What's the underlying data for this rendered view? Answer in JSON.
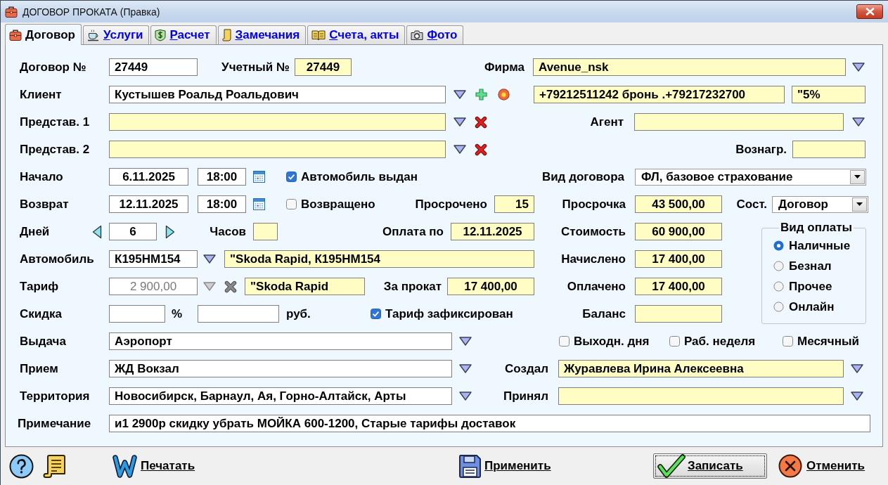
{
  "window": {
    "title": "ДОГОВОР ПРОКАТА (Правка)"
  },
  "tabs": [
    {
      "label": "Договор",
      "selected": true
    },
    {
      "label": "Услуги",
      "selected": false
    },
    {
      "label": "Расчет",
      "selected": false
    },
    {
      "label": "Замечания",
      "selected": false
    },
    {
      "label": "Счета, акты",
      "selected": false
    },
    {
      "label": "Фото",
      "selected": false
    }
  ],
  "form": {
    "rows": [
      {
        "items": [
          {
            "kind": "label",
            "text": "Договор №"
          },
          {
            "kind": "field",
            "value": "27449",
            "readonly": false
          },
          {
            "kind": "label",
            "text": "Учетный №"
          },
          {
            "kind": "field",
            "value": "27449",
            "readonly": true
          },
          {
            "kind": "label",
            "text": "Фирма"
          },
          {
            "kind": "field",
            "value": "Avenue_nsk",
            "readonly": true
          }
        ]
      },
      {
        "items": [
          {
            "kind": "label",
            "text": "Клиент"
          },
          {
            "kind": "field",
            "value": "Кустышев Роальд Роальдович",
            "readonly": false
          },
          {
            "kind": "field",
            "value": "+79212511242 бронь .+79217232700",
            "readonly": true
          },
          {
            "kind": "field",
            "value": "\"5%",
            "readonly": true
          }
        ]
      },
      {
        "items": [
          {
            "kind": "label",
            "text": "Представ. 1"
          },
          {
            "kind": "field",
            "readonly": true
          },
          {
            "kind": "label",
            "text": "Агент"
          },
          {
            "kind": "field",
            "readonly": true
          }
        ]
      },
      {
        "items": [
          {
            "kind": "label",
            "text": "Представ. 2"
          },
          {
            "kind": "field",
            "readonly": true
          },
          {
            "kind": "label",
            "text": "Вознагр."
          },
          {
            "kind": "field",
            "readonly": true
          }
        ]
      },
      {
        "items": [
          {
            "kind": "label",
            "text": "Начало"
          },
          {
            "kind": "field",
            "value": "6.11.2025",
            "readonly": false
          },
          {
            "kind": "field",
            "value": "18:00",
            "readonly": false
          },
          {
            "kind": "check",
            "label": "Автомобиль выдан",
            "checked": true
          },
          {
            "kind": "label",
            "text": "Вид договора"
          },
          {
            "kind": "combo",
            "value": "ФЛ, базовое страхование"
          }
        ]
      },
      {
        "items": [
          {
            "kind": "label",
            "text": "Возврат"
          },
          {
            "kind": "field",
            "value": "12.11.2025",
            "readonly": false
          },
          {
            "kind": "field",
            "value": "18:00",
            "readonly": false
          },
          {
            "kind": "check",
            "label": "Возвращено",
            "checked": false
          },
          {
            "kind": "label",
            "text": "Просрочено"
          },
          {
            "kind": "field",
            "value": "15",
            "readonly": true
          },
          {
            "kind": "label",
            "text": "Просрочка"
          },
          {
            "kind": "field",
            "value": "43 500,00",
            "readonly": true
          },
          {
            "kind": "label",
            "text": "Сост."
          },
          {
            "kind": "combo",
            "value": "Договор"
          }
        ]
      },
      {
        "items": [
          {
            "kind": "label",
            "text": "Дней"
          },
          {
            "kind": "field",
            "value": "6",
            "readonly": false
          },
          {
            "kind": "label",
            "text": "Часов"
          },
          {
            "kind": "field",
            "readonly": true
          },
          {
            "kind": "label",
            "text": "Оплата по"
          },
          {
            "kind": "field",
            "value": "12.11.2025",
            "readonly": true
          },
          {
            "kind": "label",
            "text": "Стоимость"
          },
          {
            "kind": "field",
            "value": "60 900,00",
            "readonly": true
          }
        ]
      },
      {
        "items": [
          {
            "kind": "label",
            "text": "Автомобиль"
          },
          {
            "kind": "field",
            "value": "К195НМ154",
            "readonly": false
          },
          {
            "kind": "field",
            "value": "\"Skoda Rapid, К195НМ154",
            "readonly": true
          },
          {
            "kind": "label",
            "text": "Начислено"
          },
          {
            "kind": "field",
            "value": "17 400,00",
            "readonly": true
          }
        ]
      },
      {
        "items": [
          {
            "kind": "label",
            "text": "Тариф"
          },
          {
            "kind": "field",
            "value": "2 900,00",
            "readonly": false,
            "disabled": true
          },
          {
            "kind": "field",
            "value": "\"Skoda Rapid",
            "readonly": true
          },
          {
            "kind": "label",
            "text": "За прокат"
          },
          {
            "kind": "field",
            "value": "17 400,00",
            "readonly": true
          },
          {
            "kind": "label",
            "text": "Оплачено"
          },
          {
            "kind": "field",
            "value": "17 400,00",
            "readonly": true
          }
        ]
      },
      {
        "items": [
          {
            "kind": "label",
            "text": "Скидка"
          },
          {
            "kind": "field",
            "readonly": false
          },
          {
            "kind": "label",
            "text": "%"
          },
          {
            "kind": "field",
            "readonly": false
          },
          {
            "kind": "label",
            "text": "руб."
          },
          {
            "kind": "check",
            "label": "Тариф зафиксирован",
            "checked": true
          },
          {
            "kind": "label",
            "text": "Баланс"
          },
          {
            "kind": "field",
            "readonly": true
          }
        ]
      },
      {
        "items": [
          {
            "kind": "label",
            "text": "Выдача"
          },
          {
            "kind": "field",
            "value": "Аэропорт",
            "readonly": false
          },
          {
            "kind": "check",
            "label": "Выходн. дня",
            "checked": false
          },
          {
            "kind": "check",
            "label": "Раб. неделя",
            "checked": false
          },
          {
            "kind": "check",
            "label": "Месячный",
            "checked": false
          }
        ]
      },
      {
        "items": [
          {
            "kind": "label",
            "text": "Прием"
          },
          {
            "kind": "field",
            "value": "ЖД Вокзал",
            "readonly": false
          },
          {
            "kind": "label",
            "text": "Создал"
          },
          {
            "kind": "field",
            "value": "Журавлева Ирина Алексеевна",
            "readonly": true
          }
        ]
      },
      {
        "items": [
          {
            "kind": "label",
            "text": "Территория"
          },
          {
            "kind": "field",
            "value": "Новосибирск, Барнаул, Ая, Горно-Алтайск, Арты",
            "readonly": false
          },
          {
            "kind": "label",
            "text": "Принял"
          },
          {
            "kind": "field",
            "readonly": true
          }
        ]
      },
      {
        "items": [
          {
            "kind": "label",
            "text": "Примечание"
          },
          {
            "kind": "field",
            "value": "и1 2900р скидку убрать МОЙКА 600-1200, Старые тарифы доставок",
            "readonly": false
          }
        ]
      }
    ]
  },
  "payment_type": {
    "title": "Вид оплаты",
    "options": [
      {
        "label": "Наличные",
        "selected": true
      },
      {
        "label": "Безнал",
        "selected": false
      },
      {
        "label": "Прочее",
        "selected": false
      },
      {
        "label": "Онлайн",
        "selected": false
      }
    ]
  },
  "buttons": [
    {
      "label": "Печатать",
      "focused": false
    },
    {
      "label": "Применить",
      "focused": false
    },
    {
      "label": "Записать",
      "focused": true
    },
    {
      "label": "Отменить",
      "focused": false
    }
  ]
}
